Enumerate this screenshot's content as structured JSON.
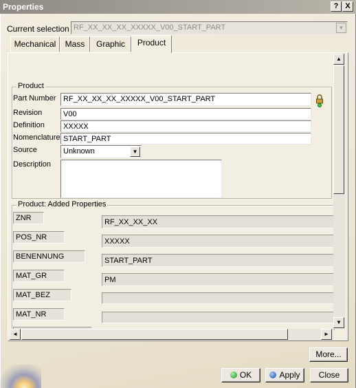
{
  "window": {
    "title": "Properties",
    "help_glyph": "?",
    "close_glyph": "X"
  },
  "current_selection": {
    "label": "Current selection :",
    "value": "RF_XX_XX_XX_XXXXX_V00_START_PART"
  },
  "tabs": [
    {
      "label": "Mechanical"
    },
    {
      "label": "Mass"
    },
    {
      "label": "Graphic"
    },
    {
      "label": "Product",
      "active": true
    }
  ],
  "product": {
    "group_title": "Product",
    "fields": [
      {
        "label": "Part Number",
        "value": "RF_XX_XX_XX_XXXXX_V00_START_PART"
      },
      {
        "label": "Revision",
        "value": "V00"
      },
      {
        "label": "Definition",
        "value": "XXXXX"
      },
      {
        "label": "Nomenclature",
        "value": "START_PART"
      }
    ],
    "source": {
      "label": "Source",
      "value": "Unknown"
    },
    "description": {
      "label": "Description",
      "value": ""
    }
  },
  "added_properties": {
    "group_title": "Product: Added Properties",
    "rows": [
      {
        "key": "ZNR",
        "value": "RF_XX_XX_XX"
      },
      {
        "key": "POS_NR",
        "value": "XXXXX"
      },
      {
        "key": "BENENNUNG",
        "value": "START_PART"
      },
      {
        "key": "MAT_GR",
        "value": "PM"
      },
      {
        "key": "MAT_BEZ",
        "value": ""
      },
      {
        "key": "MAT_NR",
        "value": ""
      }
    ]
  },
  "buttons": {
    "more": "More...",
    "ok": "OK",
    "apply": "Apply",
    "close": "Close"
  },
  "icons": {
    "lock": "padlock-icon",
    "scroll_up": "▲",
    "scroll_down": "▼",
    "scroll_left": "◄",
    "scroll_right": "►",
    "dropdown": "▼"
  }
}
